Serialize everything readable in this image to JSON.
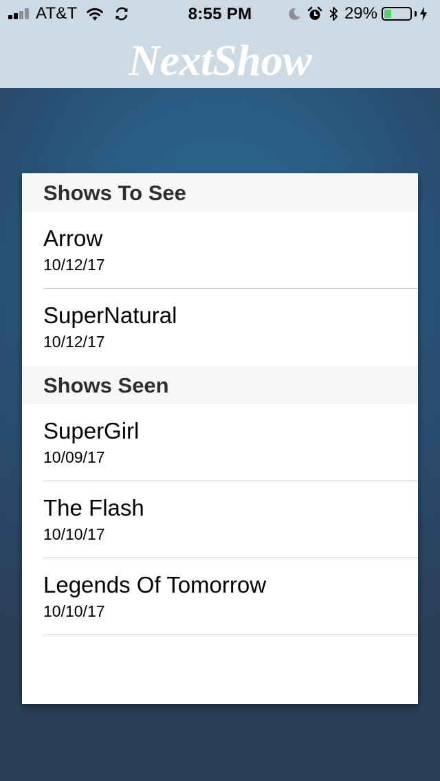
{
  "status_bar": {
    "carrier": "AT&T",
    "time": "8:55 PM",
    "battery_percent": "29%",
    "battery_level": 0.29,
    "signal_bars_active": 2,
    "signal_bars_total": 4,
    "icons": [
      "signal-bars-icon",
      "wifi-icon",
      "sync-icon",
      "moon-icon",
      "alarm-icon",
      "bluetooth-icon",
      "battery-icon",
      "charging-bolt-icon"
    ]
  },
  "header": {
    "app_title": "NextShow"
  },
  "sections": [
    {
      "title": "Shows To See",
      "items": [
        {
          "name": "Arrow",
          "date": "10/12/17"
        },
        {
          "name": "SuperNatural",
          "date": "10/12/17"
        }
      ]
    },
    {
      "title": "Shows Seen",
      "items": [
        {
          "name": "SuperGirl",
          "date": "10/09/17"
        },
        {
          "name": "The Flash",
          "date": "10/10/17"
        },
        {
          "name": "Legends Of Tomorrow",
          "date": "10/10/17"
        }
      ]
    }
  ],
  "colors": {
    "header_background": "#cdd9e3",
    "page_background": "#2a5f87",
    "section_header_background": "#f7f7f7",
    "battery_fill": "#4cd964"
  }
}
